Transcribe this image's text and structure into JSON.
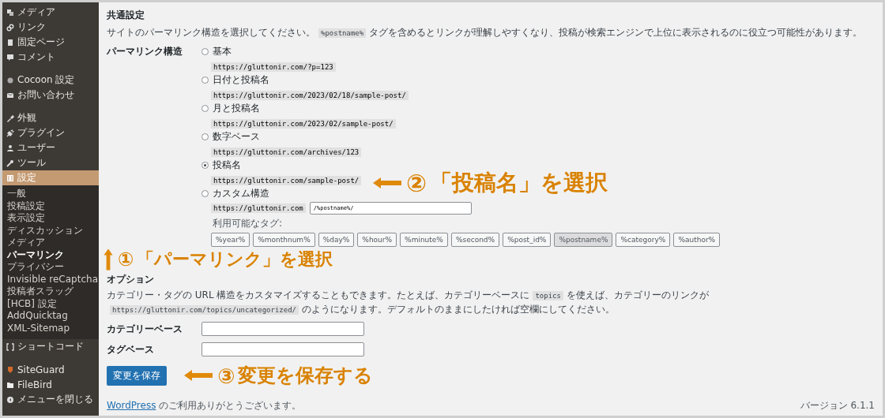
{
  "sidebar": {
    "items": [
      {
        "label": "メディア",
        "selected": false,
        "gap_before": false
      },
      {
        "label": "リンク",
        "selected": false,
        "gap_before": false
      },
      {
        "label": "固定ページ",
        "selected": false,
        "gap_before": false
      },
      {
        "label": "コメント",
        "selected": false,
        "gap_before": false
      },
      {
        "label": "Cocoon 設定",
        "selected": false,
        "gap_before": true
      },
      {
        "label": "お問い合わせ",
        "selected": false,
        "gap_before": false
      },
      {
        "label": "外観",
        "selected": false,
        "gap_before": true
      },
      {
        "label": "プラグイン",
        "selected": false,
        "gap_before": false
      },
      {
        "label": "ユーザー",
        "selected": false,
        "gap_before": false
      },
      {
        "label": "ツール",
        "selected": false,
        "gap_before": false
      },
      {
        "label": "設定",
        "selected": true,
        "gap_before": false
      }
    ],
    "submenu": [
      {
        "label": "一般",
        "selected": false
      },
      {
        "label": "投稿設定",
        "selected": false
      },
      {
        "label": "表示設定",
        "selected": false
      },
      {
        "label": "ディスカッション",
        "selected": false
      },
      {
        "label": "メディア",
        "selected": false
      },
      {
        "label": "パーマリンク",
        "selected": true
      },
      {
        "label": "プライバシー",
        "selected": false
      },
      {
        "label": "Invisible reCaptcha",
        "selected": false
      },
      {
        "label": "投稿者スラッグ",
        "selected": false
      },
      {
        "label": "[HCB] 設定",
        "selected": false
      },
      {
        "label": "AddQuicktag",
        "selected": false
      },
      {
        "label": "XML-Sitemap",
        "selected": false
      }
    ],
    "bottom_items": [
      {
        "label": "ショートコード"
      },
      {
        "label": "SiteGuard"
      },
      {
        "label": "FileBird"
      },
      {
        "label": "メニューを閉じる"
      }
    ]
  },
  "common": {
    "heading": "共通設定",
    "description_before": "サイトのパーマリンク構造を選択してください。",
    "description_code": "%postname%",
    "description_after": "タグを含めるとリンクが理解しやすくなり、投稿が検索エンジンで上位に表示されるのに役立つ可能性があります。",
    "structure_label": "パーマリンク構造",
    "options": [
      {
        "label": "基本",
        "example": "https://gluttonir.com/?p=123",
        "selected": false
      },
      {
        "label": "日付と投稿名",
        "example": "https://gluttonir.com/2023/02/18/sample-post/",
        "selected": false
      },
      {
        "label": "月と投稿名",
        "example": "https://gluttonir.com/2023/02/sample-post/",
        "selected": false
      },
      {
        "label": "数字ベース",
        "example": "https://gluttonir.com/archives/123",
        "selected": false
      },
      {
        "label": "投稿名",
        "example": "https://gluttonir.com/sample-post/",
        "selected": true
      },
      {
        "label": "カスタム構造",
        "example": "https://gluttonir.com",
        "selected": false
      }
    ],
    "custom_value": "/%postname%/",
    "tags_label": "利用可能なタグ:",
    "tags": [
      {
        "label": "%year%",
        "selected": false
      },
      {
        "label": "%monthnum%",
        "selected": false
      },
      {
        "label": "%day%",
        "selected": false
      },
      {
        "label": "%hour%",
        "selected": false
      },
      {
        "label": "%minute%",
        "selected": false
      },
      {
        "label": "%second%",
        "selected": false
      },
      {
        "label": "%post_id%",
        "selected": false
      },
      {
        "label": "%postname%",
        "selected": true
      },
      {
        "label": "%category%",
        "selected": false
      },
      {
        "label": "%author%",
        "selected": false
      }
    ]
  },
  "optional": {
    "heading": "オプション",
    "description_1": "カテゴリー・タグの URL 構造をカスタマイズすることもできます。たとえば、カテゴリーベースに",
    "code_1": "topics",
    "description_2": "を使えば、カテゴリーのリンクが",
    "code_2": "https://gluttonir.com/topics/uncategorized/",
    "description_3": "のようになります。デフォルトのままにしたければ空欄にしてください。",
    "fields": [
      {
        "label": "カテゴリーベース"
      },
      {
        "label": "タグベース"
      }
    ]
  },
  "save_button": "変更を保存",
  "footer": {
    "link": "WordPress",
    "text": "のご利用ありがとうございます。",
    "version": "バージョン 6.1.1"
  },
  "annotations": [
    {
      "kind": "left",
      "number": "②",
      "text": "「投稿名」を選択"
    },
    {
      "kind": "up",
      "number": "①",
      "text": "「パーマリンク」を選択"
    },
    {
      "kind": "left",
      "number": "③",
      "text": "変更を保存する"
    }
  ]
}
